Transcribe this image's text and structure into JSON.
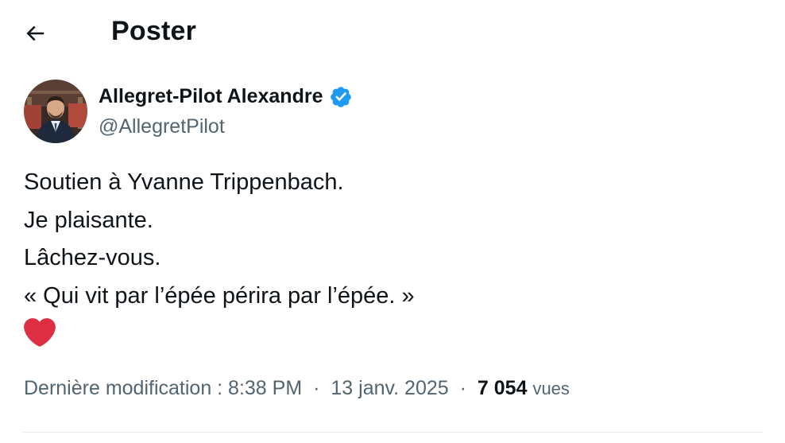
{
  "header": {
    "title": "Poster",
    "back_icon": "arrow-left-icon"
  },
  "author": {
    "display_name": "Allegret-Pilot Alexandre",
    "handle": "@AllegretPilot",
    "verified_icon": "verified-badge-icon",
    "verified_color": "#1d9bf0"
  },
  "tweet": {
    "lines": [
      "Soutien à Yvanne Trippenbach.",
      "Je plaisante.",
      "Lâchez-vous.",
      "« Qui vit par l’épée périra par l’épée. »"
    ],
    "emoji_icon": "red-heart-icon",
    "emoji_color": "#dd2e44"
  },
  "meta": {
    "edited_label": "Dernière modification : 8:38 PM",
    "date": "13 janv. 2025",
    "separator": "·",
    "views_count": "7 054",
    "views_label": "vues"
  }
}
